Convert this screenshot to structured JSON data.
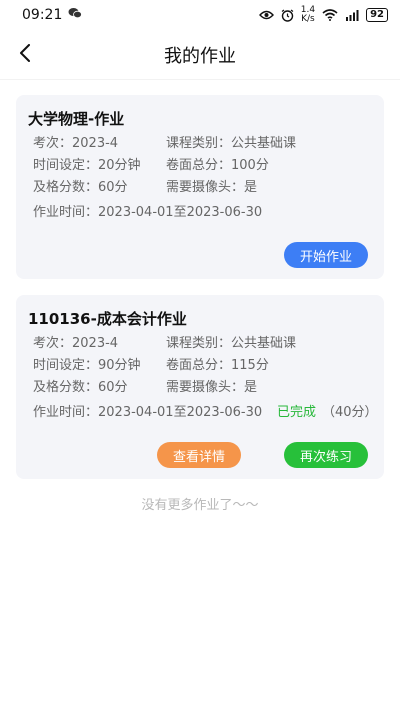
{
  "status_bar": {
    "time": "09:21",
    "net_speed_value": "1.4",
    "net_speed_unit": "K/s",
    "battery": "92"
  },
  "header": {
    "title": "我的作业"
  },
  "assignments": [
    {
      "title": "大学物理-作业",
      "exam_label": "考次：",
      "exam_value": "2023-4",
      "category_label": "课程类别：",
      "category_value": "公共基础课",
      "time_setting_label": "时间设定：",
      "time_setting_value": "20分钟",
      "total_score_label": "卷面总分：",
      "total_score_value": "100分",
      "pass_score_label": "及格分数：",
      "pass_score_value": "60分",
      "camera_label": "需要摄像头：",
      "camera_value": "是",
      "period_label": "作业时间：",
      "period_value": "2023-04-01至2023-06-30",
      "button": "开始作业"
    },
    {
      "title": "110136-成本会计作业",
      "exam_label": "考次：",
      "exam_value": "2023-4",
      "category_label": "课程类别：",
      "category_value": "公共基础课",
      "time_setting_label": "时间设定：",
      "time_setting_value": "90分钟",
      "total_score_label": "卷面总分：",
      "total_score_value": "115分",
      "pass_score_label": "及格分数：",
      "pass_score_value": "60分",
      "camera_label": "需要摄像头：",
      "camera_value": "是",
      "period_label": "作业时间：",
      "period_value": "2023-04-01至2023-06-30",
      "status": "已完成",
      "score": "（40分）",
      "button_details": "查看详情",
      "button_retry": "再次练习"
    }
  ],
  "footer_text": "没有更多作业了～～",
  "colors": {
    "primary_blue": "#3d7ef5",
    "orange": "#f5954a",
    "green": "#27c03a",
    "status_green": "#27b83a",
    "card_bg": "#f4f5f9"
  }
}
